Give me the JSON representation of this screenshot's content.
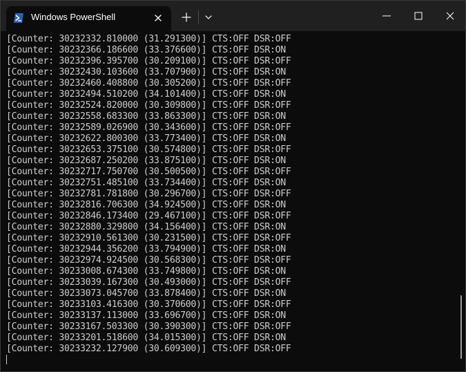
{
  "tab": {
    "title": "Windows PowerShell",
    "icon": "powershell-icon"
  },
  "titlebar": {
    "new_tab_icon": "plus-icon",
    "dropdown_icon": "chevron-down-icon",
    "minimize_icon": "minimize-icon",
    "maximize_icon": "maximize-icon",
    "close_icon": "close-icon"
  },
  "colors": {
    "background": "#0c0c0c",
    "titlebar": "#202020",
    "text": "#cccccc",
    "tab_icon": "#2b61b4"
  },
  "terminal": {
    "lines": [
      "[Counter: 30232332.810000 (31.291300)] CTS:OFF DSR:OFF",
      "[Counter: 30232366.186600 (33.376600)] CTS:OFF DSR:ON",
      "[Counter: 30232396.395700 (30.209100)] CTS:OFF DSR:OFF",
      "[Counter: 30232430.103600 (33.707900)] CTS:OFF DSR:ON",
      "[Counter: 30232460.408800 (30.305200)] CTS:OFF DSR:OFF",
      "[Counter: 30232494.510200 (34.101400)] CTS:OFF DSR:ON",
      "[Counter: 30232524.820000 (30.309800)] CTS:OFF DSR:OFF",
      "[Counter: 30232558.683300 (33.863300)] CTS:OFF DSR:ON",
      "[Counter: 30232589.026900 (30.343600)] CTS:OFF DSR:OFF",
      "[Counter: 30232622.800300 (33.773400)] CTS:OFF DSR:ON",
      "[Counter: 30232653.375100 (30.574800)] CTS:OFF DSR:OFF",
      "[Counter: 30232687.250200 (33.875100)] CTS:OFF DSR:ON",
      "[Counter: 30232717.750700 (30.500500)] CTS:OFF DSR:OFF",
      "[Counter: 30232751.485100 (33.734400)] CTS:OFF DSR:ON",
      "[Counter: 30232781.781800 (30.296700)] CTS:OFF DSR:OFF",
      "[Counter: 30232816.706300 (34.924500)] CTS:OFF DSR:ON",
      "[Counter: 30232846.173400 (29.467100)] CTS:OFF DSR:OFF",
      "[Counter: 30232880.329800 (34.156400)] CTS:OFF DSR:ON",
      "[Counter: 30232910.561300 (30.231500)] CTS:OFF DSR:OFF",
      "[Counter: 30232944.356200 (33.794900)] CTS:OFF DSR:ON",
      "[Counter: 30232974.924500 (30.568300)] CTS:OFF DSR:OFF",
      "[Counter: 30233008.674300 (33.749800)] CTS:OFF DSR:ON",
      "[Counter: 30233039.167300 (30.493000)] CTS:OFF DSR:OFF",
      "[Counter: 30233073.045700 (33.878400)] CTS:OFF DSR:ON",
      "[Counter: 30233103.416300 (30.370600)] CTS:OFF DSR:OFF",
      "[Counter: 30233137.113000 (33.696700)] CTS:OFF DSR:ON",
      "[Counter: 30233167.503300 (30.390300)] CTS:OFF DSR:OFF",
      "[Counter: 30233201.518600 (34.015300)] CTS:OFF DSR:ON",
      "[Counter: 30233232.127900 (30.609300)] CTS:OFF DSR:OFF"
    ]
  }
}
